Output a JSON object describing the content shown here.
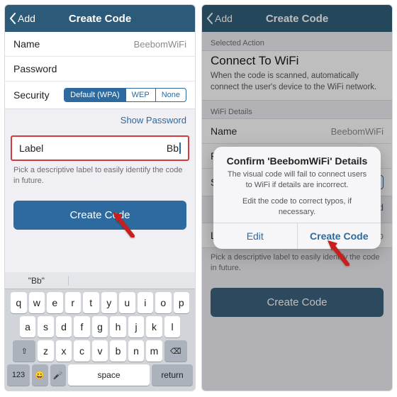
{
  "nav": {
    "back": "Add",
    "title": "Create Code"
  },
  "left": {
    "rows": {
      "name": {
        "label": "Name",
        "value": "BeebomWiFi"
      },
      "password": {
        "label": "Password",
        "value": ""
      },
      "security": {
        "label": "Security",
        "options": [
          "Default (WPA)",
          "WEP",
          "None"
        ],
        "selected": 0
      }
    },
    "show_password": "Show Password",
    "label_field": {
      "label": "Label",
      "value": "Bb"
    },
    "label_hint": "Pick a descriptive label to easily identify the code in future.",
    "create_button": "Create Code",
    "keyboard": {
      "prediction": "\"Bb\"",
      "row1": [
        "q",
        "w",
        "e",
        "r",
        "t",
        "y",
        "u",
        "i",
        "o",
        "p"
      ],
      "row2": [
        "a",
        "s",
        "d",
        "f",
        "g",
        "h",
        "j",
        "k",
        "l"
      ],
      "row3": [
        "z",
        "x",
        "c",
        "v",
        "b",
        "n",
        "m"
      ],
      "shift": "⇧",
      "del": "⌫",
      "numkey": "123",
      "emoji": "😀",
      "mic": "🎤",
      "space": "space",
      "ret": "return"
    }
  },
  "right": {
    "selected_action_header": "Selected Action",
    "action_title": "Connect To WiFi",
    "action_desc": "When the code is scanned, automatically connect the user's device to the WiFi network.",
    "wifi_header": "WiFi Details",
    "rows": {
      "name": {
        "label": "Name",
        "value": "BeebomWiFi"
      },
      "password": {
        "label": "Password",
        "value": ""
      },
      "security": {
        "label": "Security",
        "none": "None"
      }
    },
    "show_password_partial": "sword",
    "label_row": {
      "label": "Label",
      "value": "Bb"
    },
    "label_hint": "Pick a descriptive label to easily identify the code in future.",
    "create_button": "Create Code",
    "alert": {
      "title": "Confirm 'BeebomWiFi' Details",
      "line1": "The visual code will fail to connect users to WiFi if details are incorrect.",
      "line2": "Edit the code to correct typos, if necessary.",
      "edit": "Edit",
      "confirm": "Create Code"
    }
  }
}
